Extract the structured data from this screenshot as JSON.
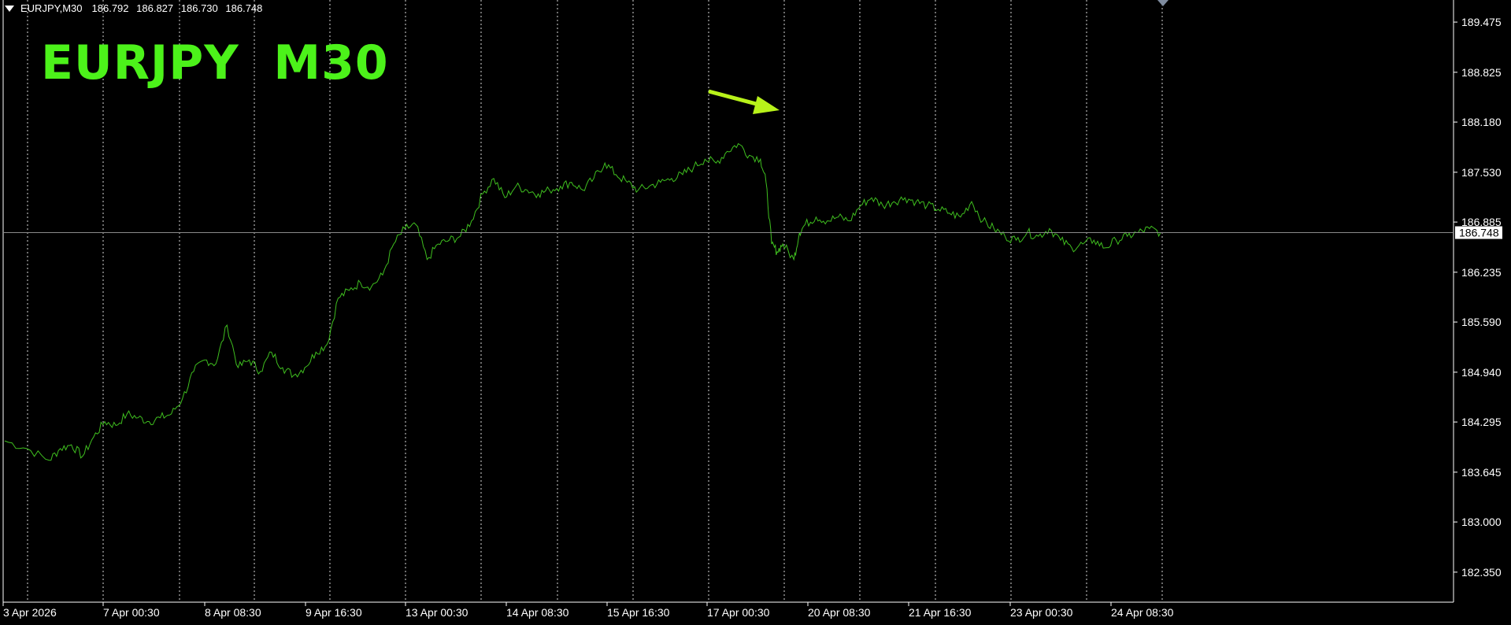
{
  "header": {
    "symbol_timeframe": "EURJPY,M30",
    "open": "186.792",
    "high": "186.827",
    "low": "186.730",
    "close": "186.748",
    "menu_icon": "triangle-down-icon"
  },
  "overlay_title": "EURJPY  M30",
  "colors": {
    "background": "#000000",
    "price_line": "#3fbf1f",
    "title": "#4cf21a",
    "arrow": "#b8f21a",
    "grid": "#ffffff",
    "axis_text": "#ffffff",
    "current_price_line": "#8a8a8a",
    "shift_marker": "#7f8c9f"
  },
  "current_price_label": "186.748",
  "chart_data": {
    "type": "line",
    "title": "",
    "xlabel": "",
    "ylabel": "",
    "grid": true,
    "grid_style": "vertical dotted",
    "ylim": [
      181.9,
      189.7
    ],
    "y_ticks": [
      "189.475",
      "188.825",
      "188.180",
      "187.530",
      "186.885",
      "186.235",
      "185.590",
      "184.940",
      "184.295",
      "183.645",
      "183.000",
      "182.350"
    ],
    "x_ticks": [
      "3 Apr 2026",
      "7 Apr 00:30",
      "8 Apr 08:30",
      "9 Apr 16:30",
      "13 Apr 00:30",
      "14 Apr 08:30",
      "15 Apr 16:30",
      "17 Apr 00:30",
      "20 Apr 08:30",
      "21 Apr 16:30",
      "23 Apr 00:30",
      "24 Apr 08:30"
    ],
    "series": [
      {
        "values": [
          [
            0,
            184.05
          ],
          [
            2,
            183.95
          ],
          [
            4,
            183.8
          ],
          [
            5,
            183.95
          ],
          [
            6,
            184.0
          ],
          [
            7,
            183.85
          ],
          [
            8,
            184.1
          ],
          [
            9,
            184.3
          ],
          [
            10,
            184.25
          ],
          [
            11,
            184.4
          ],
          [
            12,
            184.35
          ],
          [
            13,
            184.3
          ],
          [
            14,
            184.35
          ],
          [
            15,
            184.4
          ],
          [
            16,
            184.6
          ],
          [
            17,
            184.95
          ],
          [
            18,
            185.1
          ],
          [
            19,
            185.05
          ],
          [
            20,
            185.55
          ],
          [
            21,
            185.0
          ],
          [
            22,
            185.1
          ],
          [
            23,
            184.95
          ],
          [
            24,
            185.2
          ],
          [
            25,
            185.0
          ],
          [
            26,
            184.9
          ],
          [
            27,
            185.0
          ],
          [
            28,
            185.2
          ],
          [
            29,
            185.3
          ],
          [
            30,
            185.9
          ],
          [
            31,
            186.0
          ],
          [
            32,
            186.1
          ],
          [
            33,
            186.05
          ],
          [
            34,
            186.2
          ],
          [
            35,
            186.6
          ],
          [
            36,
            186.8
          ],
          [
            37,
            186.85
          ],
          [
            38,
            186.4
          ],
          [
            39,
            186.6
          ],
          [
            40,
            186.65
          ],
          [
            41,
            186.7
          ],
          [
            42,
            186.9
          ],
          [
            43,
            187.25
          ],
          [
            44,
            187.45
          ],
          [
            45,
            187.2
          ],
          [
            46,
            187.35
          ],
          [
            47,
            187.3
          ],
          [
            48,
            187.25
          ],
          [
            49,
            187.3
          ],
          [
            50,
            187.35
          ],
          [
            51,
            187.4
          ],
          [
            52,
            187.3
          ],
          [
            53,
            187.45
          ],
          [
            54,
            187.65
          ],
          [
            55,
            187.5
          ],
          [
            56,
            187.4
          ],
          [
            57,
            187.3
          ],
          [
            58,
            187.35
          ],
          [
            59,
            187.4
          ],
          [
            60,
            187.45
          ],
          [
            61,
            187.5
          ],
          [
            62,
            187.6
          ],
          [
            63,
            187.7
          ],
          [
            64,
            187.65
          ],
          [
            65,
            187.8
          ],
          [
            66,
            187.9
          ],
          [
            67,
            187.75
          ],
          [
            68,
            187.7
          ],
          [
            68.5,
            187.4
          ],
          [
            69,
            186.6
          ],
          [
            69.5,
            186.5
          ],
          [
            70,
            186.6
          ],
          [
            71,
            186.4
          ],
          [
            71.5,
            186.75
          ],
          [
            72,
            186.85
          ],
          [
            73,
            186.95
          ],
          [
            74,
            186.9
          ],
          [
            75,
            186.95
          ],
          [
            76,
            186.9
          ],
          [
            77,
            187.1
          ],
          [
            78,
            187.2
          ],
          [
            79,
            187.1
          ],
          [
            80,
            187.15
          ],
          [
            81,
            187.2
          ],
          [
            82,
            187.15
          ],
          [
            83,
            187.1
          ],
          [
            84,
            187.05
          ],
          [
            85,
            187.0
          ],
          [
            86,
            186.95
          ],
          [
            87,
            187.15
          ],
          [
            88,
            186.9
          ],
          [
            89,
            186.8
          ],
          [
            90,
            186.7
          ],
          [
            91,
            186.65
          ],
          [
            92,
            186.75
          ],
          [
            93,
            186.7
          ],
          [
            94,
            186.8
          ],
          [
            95,
            186.65
          ],
          [
            96,
            186.55
          ],
          [
            97,
            186.6
          ],
          [
            98,
            186.65
          ],
          [
            99,
            186.55
          ],
          [
            100,
            186.65
          ],
          [
            101,
            186.7
          ],
          [
            102,
            186.75
          ],
          [
            103,
            186.8
          ],
          [
            104,
            186.75
          ]
        ]
      }
    ],
    "annotation": "arrow"
  }
}
